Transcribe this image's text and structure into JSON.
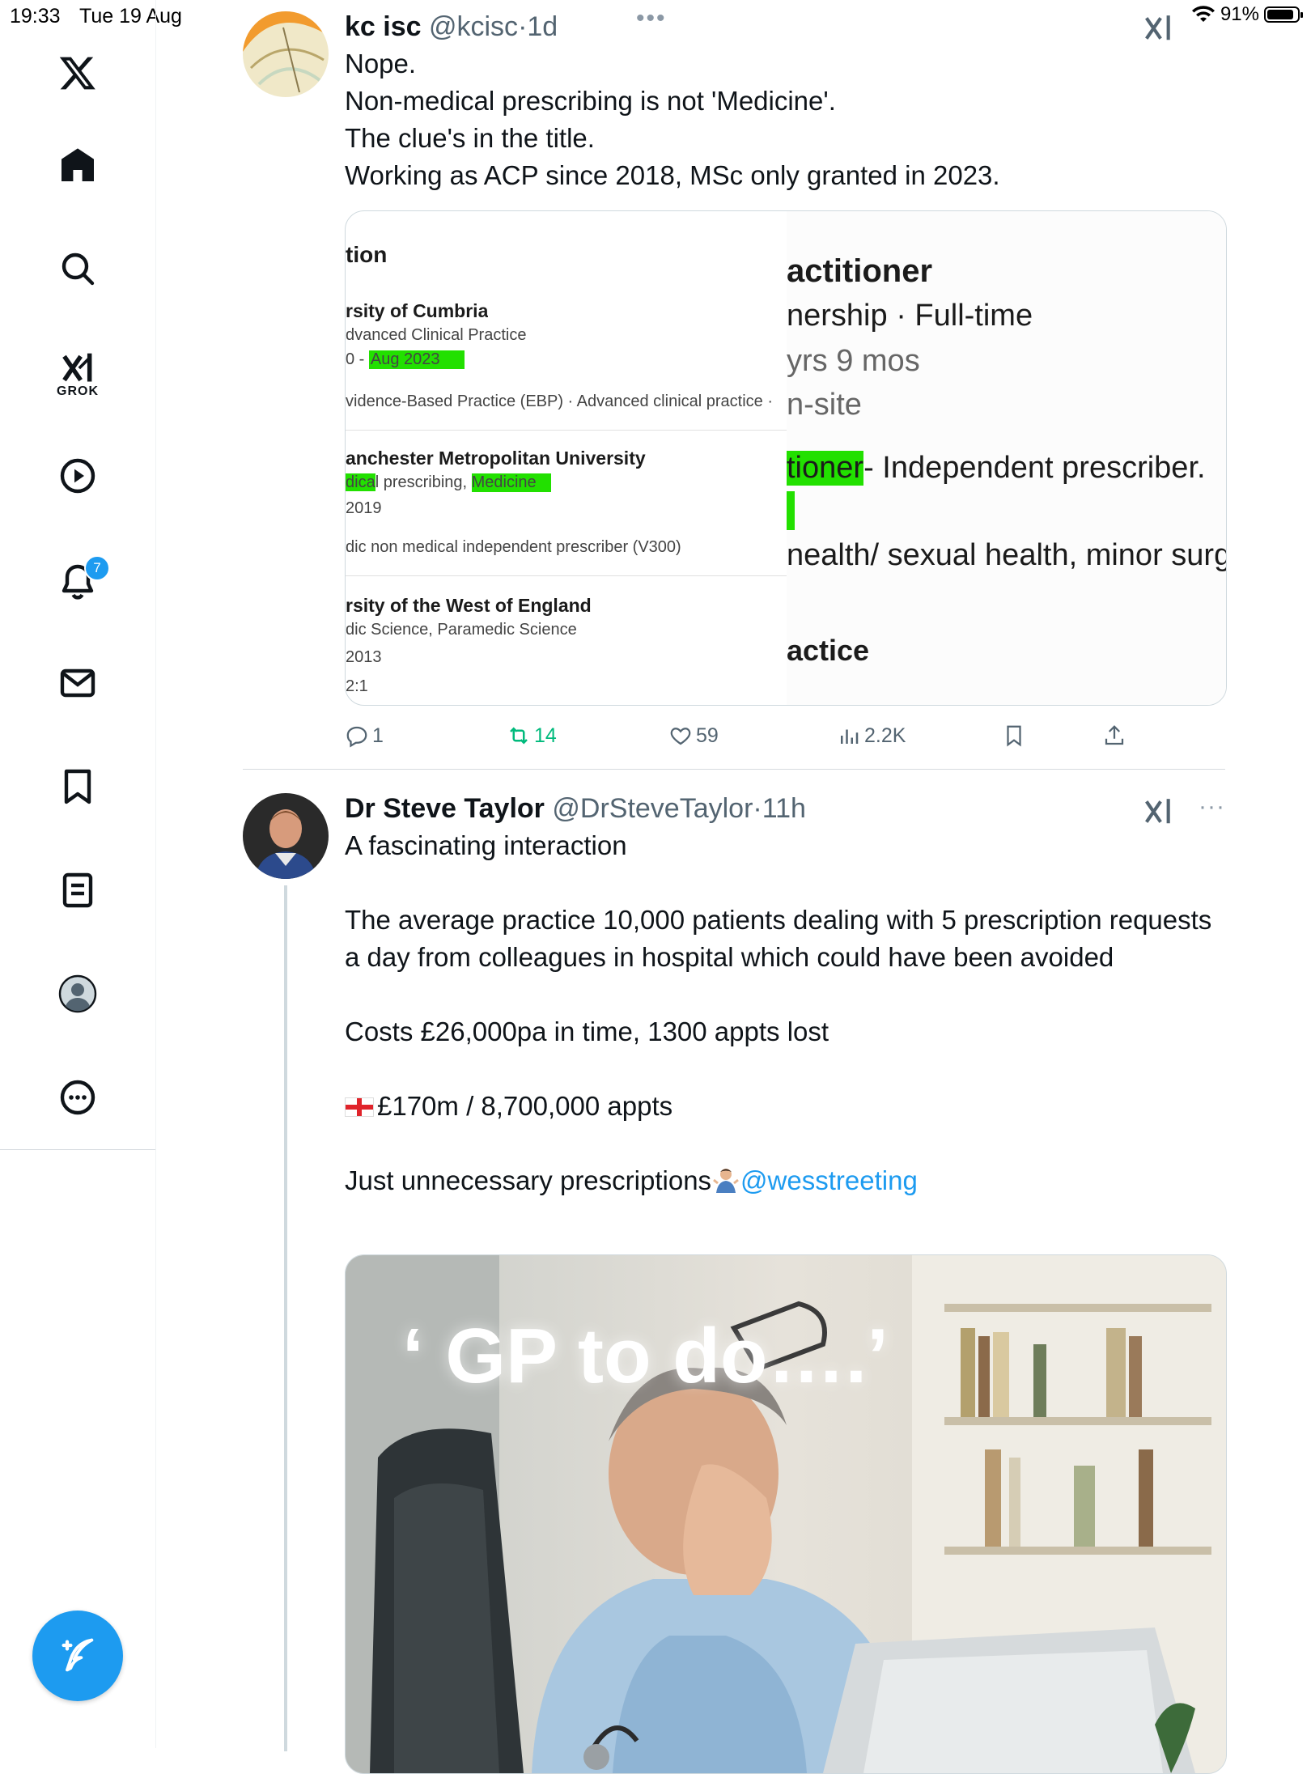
{
  "status_bar": {
    "time": "19:33",
    "date": "Tue 19 Aug",
    "battery": "91%",
    "battery_level": 0.91
  },
  "top_more": "•••",
  "sidebar": {
    "items": [
      {
        "icon": "x-logo-icon"
      },
      {
        "icon": "home-icon"
      },
      {
        "icon": "search-icon"
      },
      {
        "icon": "grok-icon",
        "label": "GROK"
      },
      {
        "icon": "video-icon"
      },
      {
        "icon": "notifications-icon",
        "badge": "7"
      },
      {
        "icon": "messages-icon"
      },
      {
        "icon": "bookmarks-icon"
      },
      {
        "icon": "lists-icon"
      },
      {
        "icon": "profile-icon"
      },
      {
        "icon": "more-icon"
      }
    ],
    "compose_icon": "compose-post-icon"
  },
  "posts": [
    {
      "display_name": "kc isc",
      "handle": "@kcisc",
      "sep": "·",
      "time": "1d",
      "text": "Nope.\nNon-medical prescribing is not 'Medicine'.\nThe clue's in the title.\nWorking as ACP since 2018, MSc only granted in 2023.",
      "screenshot": {
        "left": {
          "heading": "tion",
          "uni1": "rsity of Cumbria",
          "uni1_course": "dvanced Clinical Practice",
          "uni1_dates_prefix": "0 - ",
          "uni1_dates_hl": "Aug 2023",
          "uni1_skills": "vidence-Based Practice (EBP) · Advanced clinical practice ·",
          "uni2": "anchester Metropolitan University",
          "uni2_course_hl1": "dica",
          "uni2_course_mid": "l prescribing, ",
          "uni2_course_hl2": "Medicine",
          "uni2_year": "2019",
          "uni2_note": "dic non medical independent prescriber (V300)",
          "uni3": "rsity of the West of England",
          "uni3_course": "dic Science, Paramedic Science",
          "uni3_year": "2013",
          "uni3_grade": "2:1"
        },
        "right": {
          "line1": "actitioner",
          "line2": "nership · Full-time",
          "line3": "yrs 9 mos",
          "line4": "n-site",
          "line5_hl": "tioner",
          "line5_rest": "- Independent prescriber.",
          "line6": "nealth/ sexual health, minor surg",
          "line7": "actice"
        }
      },
      "actions": {
        "replies": "1",
        "reposts": "14",
        "likes": "59",
        "views": "2.2K"
      }
    },
    {
      "display_name": "Dr Steve Taylor",
      "handle": "@DrSteveTaylor",
      "sep": "·",
      "time": "11h",
      "more": "···",
      "text_p1": "A fascinating interaction\n\nThe average practice 10,000 patients dealing with 5 prescription requests a day from colleagues in hospital which could have been avoided\n\nCosts £26,000pa in time, 1300 appts lost\n\n",
      "text_flag_line": "£170m / 8,700,000 appts",
      "text_last": "Just unnecessary prescriptions",
      "mention": "@wesstreeting",
      "image_caption": "‘ GP to do….’"
    }
  ]
}
